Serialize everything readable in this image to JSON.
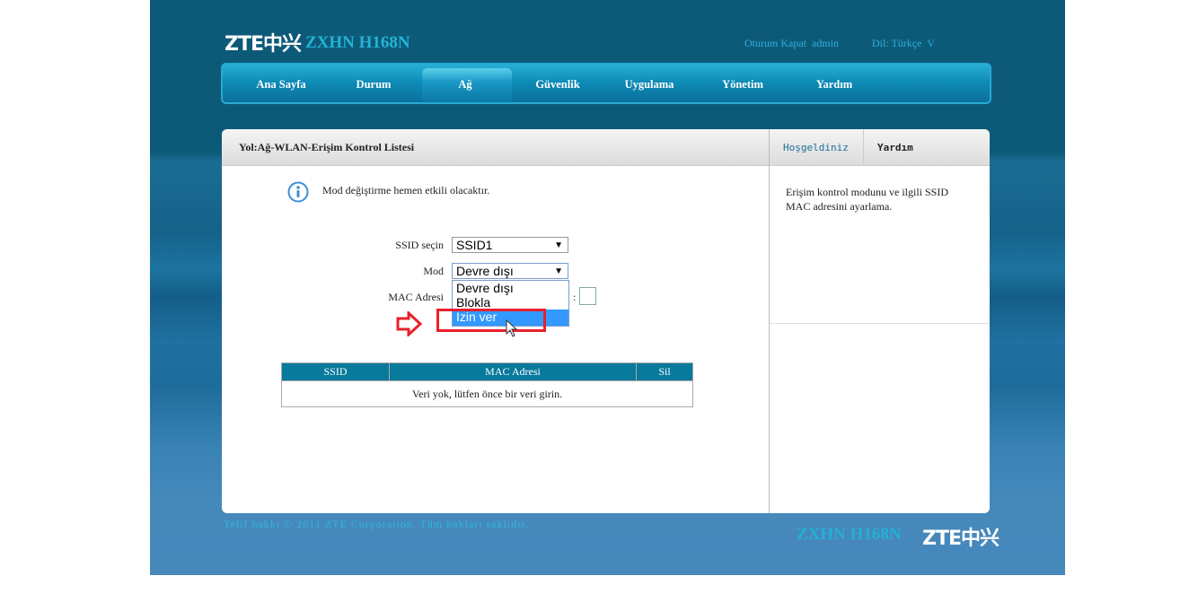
{
  "header": {
    "brand": "ZTE中兴",
    "model": "ZXHN H168N",
    "logout": "Oturum Kapat",
    "user": "admin",
    "language": "Dil: Türkçe",
    "language_arrow": "V"
  },
  "nav": [
    {
      "label": "Ana Sayfa"
    },
    {
      "label": "Durum"
    },
    {
      "label": "Ağ",
      "active": true
    },
    {
      "label": "Güvenlik"
    },
    {
      "label": "Uygulama"
    },
    {
      "label": "Yönetim"
    },
    {
      "label": "Yardım"
    }
  ],
  "main": {
    "breadcrumb": "Yol:Ağ-WLAN-Erişim Kontrol Listesi",
    "info": "Mod değiştirme hemen etkili olacaktır.",
    "ssid_label": "SSID seçin",
    "ssid_value": "SSID1",
    "mode_label": "Mod",
    "mode_value": "Devre dışı",
    "mac_label": "MAC Adresi",
    "mac_sep": ":",
    "mode_options": [
      "Devre dışı",
      "Blokla",
      "İzin ver"
    ],
    "table": {
      "headers": [
        "SSID",
        "MAC Adresi",
        "Sil"
      ],
      "empty": "Veri yok, lütfen önce bir veri girin."
    }
  },
  "side": {
    "tab_welcome": "Hoşgeldiniz",
    "tab_help": "Yardım",
    "help_text": "Erişim kontrol modunu ve ilgili SSID MAC adresini ayarlama."
  },
  "footer": {
    "copyright": "Telif hakkı © 2011 ZTE Corporation. Tüm hakları saklıdır.",
    "model": "ZXHN H168N",
    "brand": "ZTE中兴"
  },
  "colors": {
    "accent": "#087a9c",
    "highlight": "#3399ff",
    "annotation": "#e8202a"
  }
}
